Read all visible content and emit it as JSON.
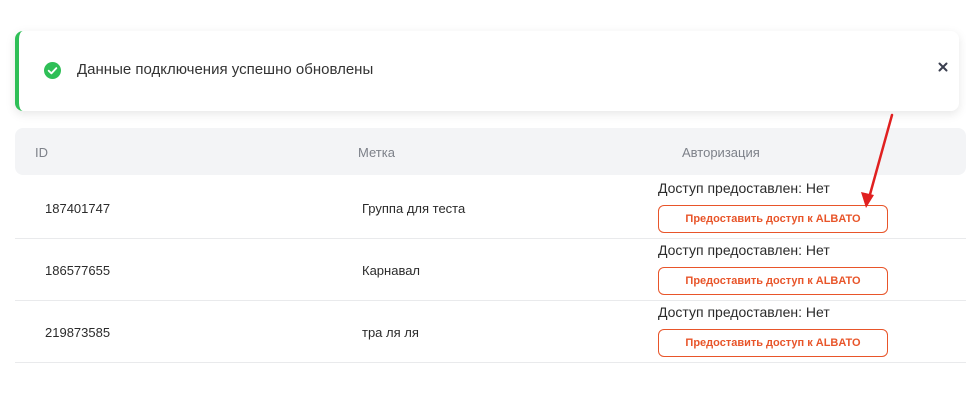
{
  "notification": {
    "message": "Данные подключения успешно обновлены",
    "icon": "check-circle-icon",
    "close_icon": "close-icon",
    "accent_color": "#2fbf57"
  },
  "table": {
    "headers": {
      "id": "ID",
      "label": "Метка",
      "auth": "Авторизация"
    },
    "rows": [
      {
        "id": "187401747",
        "label": "Группа для теста",
        "access_status": "Доступ предоставлен: Нет",
        "action": "Предоставить доступ к ALBATO"
      },
      {
        "id": "186577655",
        "label": "Карнавал",
        "access_status": "Доступ предоставлен: Нет",
        "action": "Предоставить доступ к ALBATO"
      },
      {
        "id": "219873585",
        "label": "тра ля ля",
        "access_status": "Доступ предоставлен: Нет",
        "action": "Предоставить доступ к ALBATO"
      }
    ]
  },
  "colors": {
    "action": "#e8552a",
    "header_bg": "#f3f4f6",
    "annotation_arrow": "#e02020"
  }
}
